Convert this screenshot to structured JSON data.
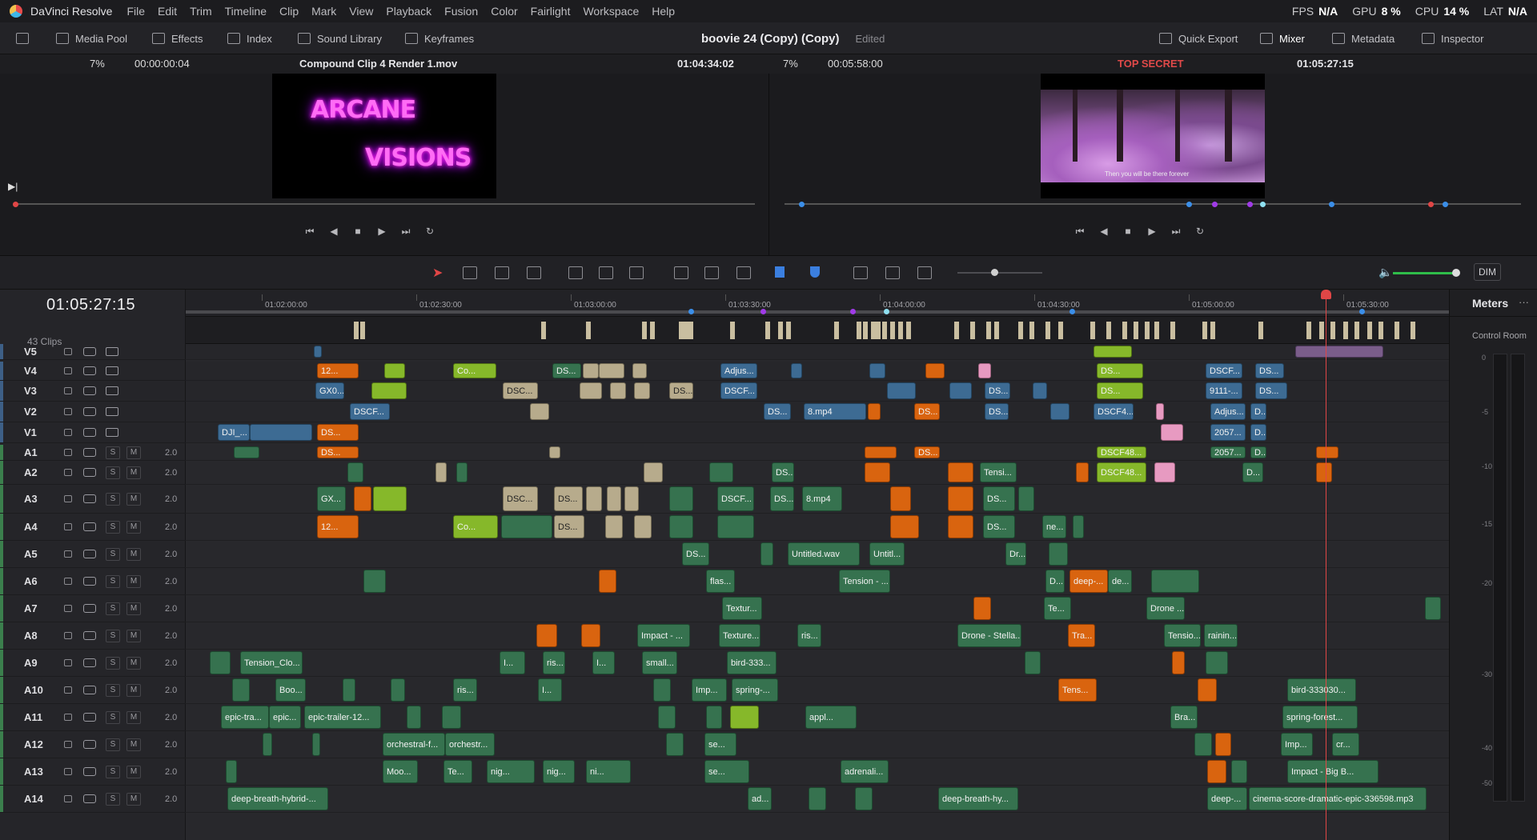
{
  "app": {
    "name": "DaVinci Resolve"
  },
  "menu": [
    "File",
    "Edit",
    "Trim",
    "Timeline",
    "Clip",
    "Mark",
    "View",
    "Playback",
    "Fusion",
    "Color",
    "Fairlight",
    "Workspace",
    "Help"
  ],
  "perf": {
    "fps_label": "FPS",
    "fps": "N/A",
    "gpu_label": "GPU",
    "gpu": "8 %",
    "cpu_label": "CPU",
    "cpu": "14 %",
    "lat_label": "LAT",
    "lat": "N/A"
  },
  "toolbar": {
    "media_pool": "Media Pool",
    "effects": "Effects",
    "index": "Index",
    "sound_library": "Sound Library",
    "keyframes": "Keyframes",
    "project_title": "boovie 24 (Copy) (Copy)",
    "project_state": "Edited",
    "quick_export": "Quick Export",
    "mixer": "Mixer",
    "metadata": "Metadata",
    "inspector": "Inspector"
  },
  "source_viewer": {
    "zoom": "7%",
    "duration": "00:00:00:04",
    "clip_name": "Compound Clip 4 Render 1.mov",
    "timecode": "01:04:34:02",
    "title_line1": "ARCANE",
    "title_line2": "VISIONS"
  },
  "program_viewer": {
    "zoom": "7%",
    "duration": "00:05:58:00",
    "timeline_name": "TOP SECRET",
    "timecode": "01:05:27:15",
    "subtitle": "Then you will be there forever"
  },
  "timeline": {
    "timecode": "01:05:27:15",
    "clip_count": "43 Clips",
    "ruler": [
      "01:02:00:00",
      "01:02:30:00",
      "01:03:00:00",
      "01:03:30:00",
      "01:04:00:00",
      "01:04:30:00",
      "01:05:00:00",
      "01:05:30:00"
    ],
    "video_tracks": [
      "V5",
      "V4",
      "V3",
      "V2",
      "V1"
    ],
    "audio_tracks": [
      "A1",
      "A2",
      "A3",
      "A4",
      "A5",
      "A6",
      "A7",
      "A8",
      "A9",
      "A10",
      "A11",
      "A12",
      "A13",
      "A14"
    ],
    "audio_level": "2.0",
    "solo_label": "S",
    "mute_label": "M",
    "dim_label": "DIM"
  },
  "clips": {
    "v4": [
      "12...",
      "Co...",
      "DS...",
      "Adjus...",
      "DS...",
      "DSCF...",
      "DS..."
    ],
    "v3": [
      "GX0...",
      "DSC...",
      "DS...",
      "DSCF...",
      "DS...",
      "DS...",
      "9111-...",
      "DS..."
    ],
    "v2": [
      "DSCF...",
      "DS...",
      "8.mp4",
      "DS...",
      "DS...",
      "DSCF4...",
      "Adjus...",
      "D..."
    ],
    "v1": [
      "DJI_...",
      "DS...",
      "2057...",
      "D..."
    ],
    "a1": [
      "DS...",
      "DS...",
      "DSCF48...",
      "2057...",
      "D..."
    ],
    "a2": [
      "DS...",
      "Tensi...",
      "DSCF48...",
      "D..."
    ],
    "a3": [
      "GX...",
      "DSC...",
      "DS...",
      "DSCF...",
      "DS...",
      "8.mp4",
      "DS..."
    ],
    "a4": [
      "12...",
      "Co...",
      "DS...",
      "DS...",
      "ne..."
    ],
    "a5": [
      "DS...",
      "Untitled.wav",
      "Untitl...",
      "Dr..."
    ],
    "a6": [
      "flas...",
      "Tension - ...",
      "D...",
      "deep-...",
      "de..."
    ],
    "a7": [
      "Textur...",
      "Te...",
      "Drone ..."
    ],
    "a8": [
      "Impact - ...",
      "Texture...",
      "ris...",
      "Drone - Stella...",
      "Tra...",
      "Tensio...",
      "rainin..."
    ],
    "a9": [
      "Tension_Clo...",
      "I...",
      "ris...",
      "I...",
      "small...",
      "bird-333..."
    ],
    "a10": [
      "Boo...",
      "ris...",
      "I...",
      "Imp...",
      "spring-...",
      "Tens...",
      "bird-333030..."
    ],
    "a11": [
      "epic-tra...",
      "epic...",
      "epic-trailer-12...",
      "appl...",
      "Bra...",
      "spring-forest..."
    ],
    "a12": [
      "orchestral-f...",
      "orchestr...",
      "se...",
      "Imp...",
      "cr..."
    ],
    "a13": [
      "Moo...",
      "Te...",
      "nig...",
      "nig...",
      "ni...",
      "se...",
      "adrenali...",
      "Impact - Big B..."
    ],
    "a14": [
      "deep-breath-hybrid-...",
      "ad...",
      "deep-breath-hy...",
      "deep-...",
      "cinema-score-dramatic-epic-336598.mp3"
    ]
  },
  "meters": {
    "title": "Meters",
    "control_room": "Control Room",
    "scale": [
      "0",
      "-5",
      "-10",
      "-15",
      "-20",
      "-30",
      "-40",
      "-50"
    ]
  },
  "colors": {
    "accent_red": "#e04646",
    "audio_green": "#36724f",
    "orange": "#d9640f",
    "video_blue": "#3d6b93",
    "tan": "#b7ab8c",
    "lime": "#86b82a",
    "pink": "#e79ac1"
  }
}
